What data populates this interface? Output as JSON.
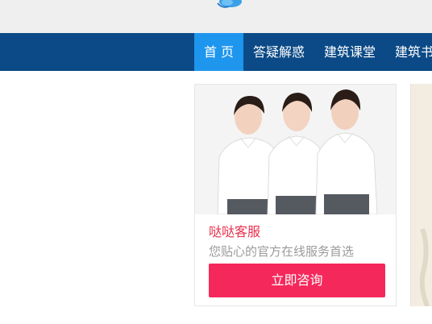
{
  "nav": {
    "items": [
      {
        "label": "首 页",
        "active": true
      },
      {
        "label": "答疑解惑",
        "active": false
      },
      {
        "label": "建筑课堂",
        "active": false
      },
      {
        "label": "建筑书",
        "active": false
      }
    ]
  },
  "service_card": {
    "title": "哒哒客服",
    "subtitle": "您贴心的官方在线服务首选",
    "button_label": "立即咨询"
  },
  "colors": {
    "nav_bg": "#0b4a86",
    "nav_active": "#1e96ee",
    "accent_red": "#f5285c",
    "title_red": "#e8304d"
  }
}
